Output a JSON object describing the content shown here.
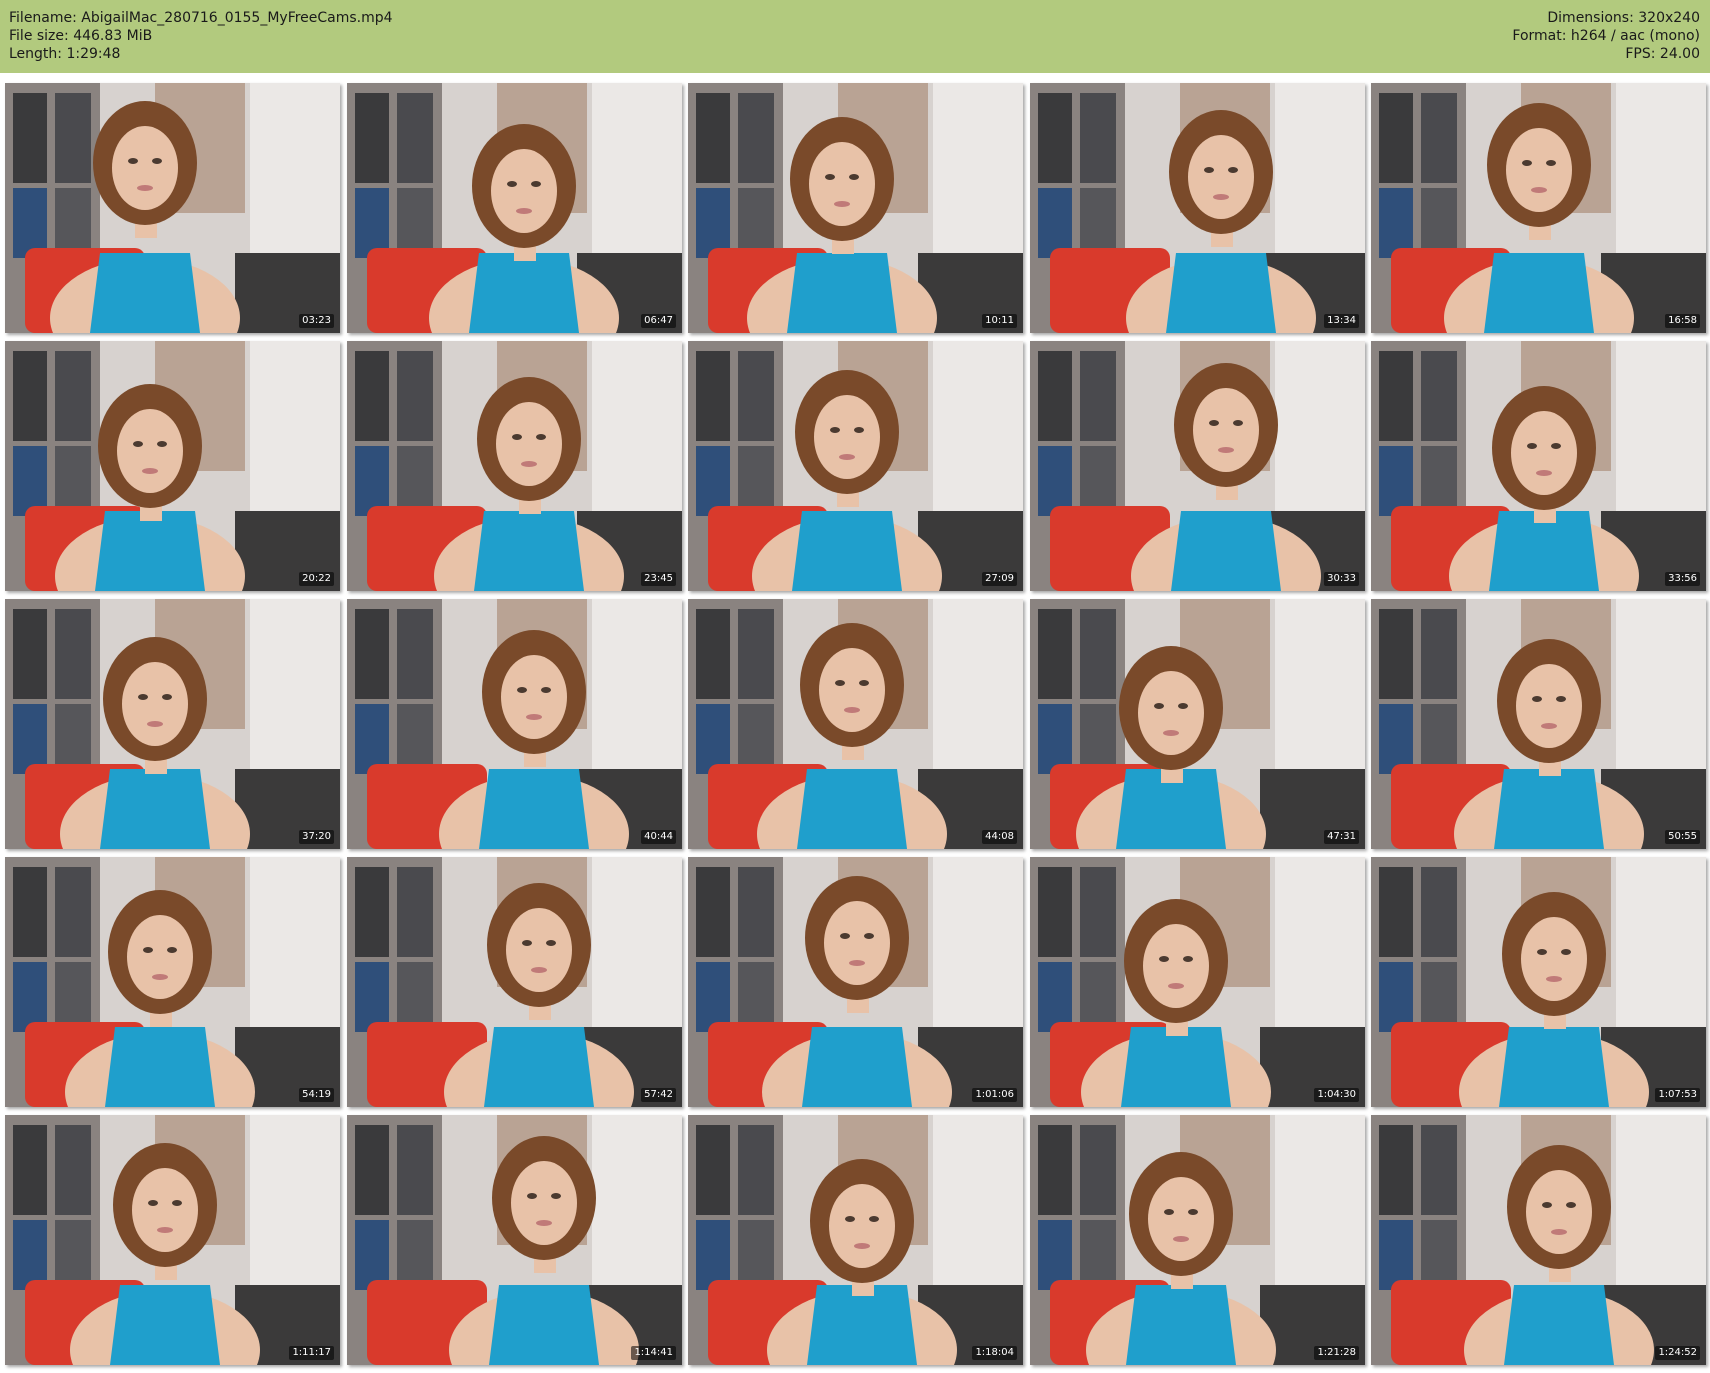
{
  "header": {
    "filename": "Filename: AbigailMac_280716_0155_MyFreeCams.mp4",
    "filesize": "File size: 446.83 MiB",
    "length": "Length: 1:29:48",
    "dimensions": "Dimensions: 320x240",
    "format": "Format: h264 / aac (mono)",
    "fps": "FPS: 24.00"
  },
  "colors": {
    "header_bg": "#b2ca7e",
    "tank_top": "#1f9fcc",
    "couch": "#d93a2c",
    "hair": "#7a4a2a",
    "skin": "#e8c2a8"
  },
  "thumbnails": [
    {
      "time": "03:23"
    },
    {
      "time": "06:47"
    },
    {
      "time": "10:11"
    },
    {
      "time": "13:34"
    },
    {
      "time": "16:58"
    },
    {
      "time": "20:22"
    },
    {
      "time": "23:45"
    },
    {
      "time": "27:09"
    },
    {
      "time": "30:33"
    },
    {
      "time": "33:56"
    },
    {
      "time": "37:20"
    },
    {
      "time": "40:44"
    },
    {
      "time": "44:08"
    },
    {
      "time": "47:31"
    },
    {
      "time": "50:55"
    },
    {
      "time": "54:19"
    },
    {
      "time": "57:42"
    },
    {
      "time": "1:01:06"
    },
    {
      "time": "1:04:30"
    },
    {
      "time": "1:07:53"
    },
    {
      "time": "1:11:17"
    },
    {
      "time": "1:14:41"
    },
    {
      "time": "1:18:04"
    },
    {
      "time": "1:21:28"
    },
    {
      "time": "1:24:52"
    }
  ]
}
